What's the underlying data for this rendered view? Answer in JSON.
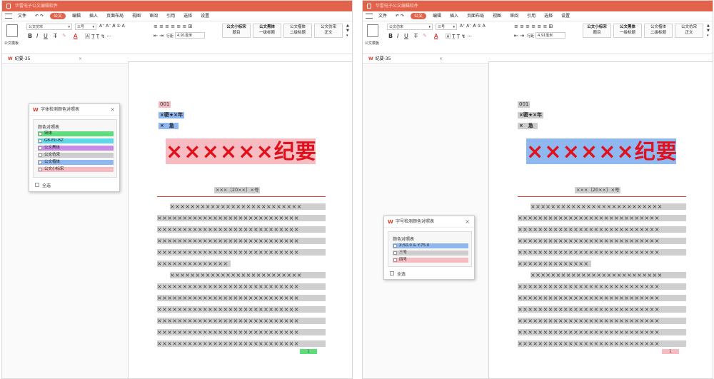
{
  "app": {
    "title": "华雷电子公文编辑软件"
  },
  "menu": [
    "文件",
    "公文",
    "编辑",
    "插入",
    "页面布局",
    "视图",
    "审阅",
    "引用",
    "选择",
    "设置"
  ],
  "ribbon": {
    "doc_button": "公文模板",
    "font_name": "公文仿宋",
    "font_size": "三号",
    "line_spacing_label": "行距",
    "line_spacing_value": "4.91毫米",
    "styles": [
      {
        "name": "公文小标宋",
        "sub": "题目"
      },
      {
        "name": "公文黑体",
        "sub": "一级标题"
      },
      {
        "name": "公文楷体",
        "sub": "二级标题"
      },
      {
        "name": "公文仿宋",
        "sub": "正文"
      }
    ]
  },
  "tab": {
    "label": "纪要-35"
  },
  "document": {
    "code": "001",
    "secret": "×密★×年",
    "urgency": "×　急",
    "heading": "××××××纪要",
    "number": "×××〔20××〕×号",
    "body_line": "××××××××××××××××××××××××××××",
    "body_line_indent": "××××××××××××××××××××××××××",
    "body_short": "××××××××××××××",
    "page_num": "1"
  },
  "left_dialog": {
    "title": "字体检测颜色对照表",
    "legend_title": "颜色对照表",
    "items": [
      {
        "label": "宋体",
        "color": "#5fdc7c"
      },
      {
        "label": "GB-EU-BZ",
        "color": "#5fd8e8"
      },
      {
        "label": "公文黑体",
        "color": "#c88ce8"
      },
      {
        "label": "公文仿宋",
        "color": "#cdcdcd"
      },
      {
        "label": "公文楷体",
        "color": "#8fb8f0"
      },
      {
        "label": "公文小标宋",
        "color": "#f6bcc2"
      }
    ],
    "select_all": "全选"
  },
  "right_dialog": {
    "title": "字号检测颜色对照表",
    "legend_title": "颜色对照表",
    "items": [
      {
        "label": "X:50.0 & Y:75.0",
        "color": "#8fb8f0"
      },
      {
        "label": "三号",
        "color": "#cdcdcd"
      },
      {
        "label": "四号",
        "color": "#f6bcc2"
      }
    ],
    "select_all": "全选"
  },
  "colors": {
    "accent": "#e2634b",
    "red_text": "#e0101c"
  }
}
